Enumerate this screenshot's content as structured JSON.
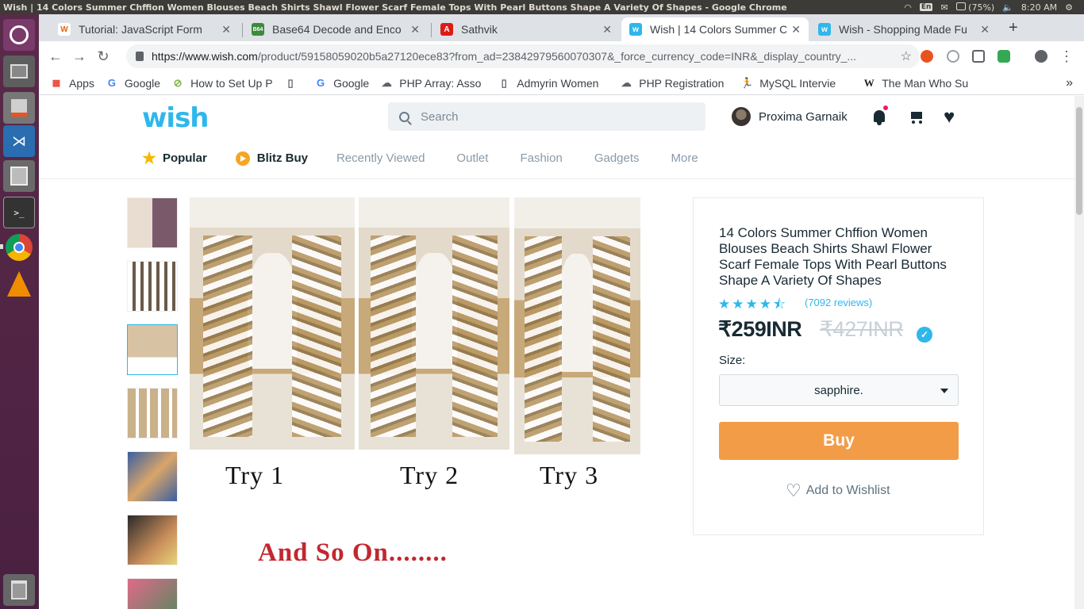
{
  "os": {
    "window_title": "Wish | 14 Colors Summer Chffion Women Blouses Beach Shirts Shawl Flower Scarf Female Tops With Pearl Buttons Shape A Variety Of Shapes - Google Chrome",
    "lang": "En",
    "battery": "(75%)",
    "clock": "8:20 AM"
  },
  "tabs": [
    {
      "label": "Tutorial: JavaScript Form",
      "favicon": "W",
      "favicon_color": "#f2f2f2"
    },
    {
      "label": "Base64 Decode and Enco",
      "favicon": "B64",
      "favicon_color": "#3c8a3c"
    },
    {
      "label": "Sathvik",
      "favicon": "A",
      "favicon_color": "#dd1b16"
    },
    {
      "label": "Wish | 14 Colors Summer C",
      "favicon": "w",
      "favicon_color": "#2fb7ec"
    },
    {
      "label": "Wish - Shopping Made Fu",
      "favicon": "w",
      "favicon_color": "#2fb7ec"
    }
  ],
  "omnibox": {
    "host": "https://www.wish.com",
    "path": "/product/59158059020b5a27120ece83?from_ad=23842979560070307&_force_currency_code=INR&_display_country_..."
  },
  "bookmarks": [
    {
      "label": "Apps",
      "icon": "apps-grid"
    },
    {
      "label": "Google",
      "icon": "google-g"
    },
    {
      "label": "How to Set Up P",
      "icon": "leaf"
    },
    {
      "label": "",
      "icon": "page"
    },
    {
      "label": "Google",
      "icon": "google-g"
    },
    {
      "label": "PHP Array: Asso",
      "icon": "cloud"
    },
    {
      "label": "Admyrin Women",
      "icon": "page"
    },
    {
      "label": "PHP Registration",
      "icon": "cloud"
    },
    {
      "label": "MySQL Intervie",
      "icon": "figure"
    },
    {
      "label": "The Man Who Su",
      "icon": "wiki-w"
    }
  ],
  "site": {
    "logo": "wish",
    "search_placeholder": "Search",
    "user_name": "Proxima Garnaik",
    "nav": [
      {
        "label": "Popular",
        "icon": "star-icon"
      },
      {
        "label": "Blitz Buy",
        "icon": "blitz-icon"
      },
      {
        "label": "Recently Viewed"
      },
      {
        "label": "Outlet"
      },
      {
        "label": "Fashion"
      },
      {
        "label": "Gadgets"
      },
      {
        "label": "More"
      }
    ]
  },
  "product": {
    "title": "14 Colors Summer Chffion Women Blouses Beach Shirts Shawl Flower Scarf Female Tops With Pearl Buttons Shape A Variety Of Shapes",
    "rating_stars": "★★★★⯪",
    "rating": 4.5,
    "reviews": "(7092 reviews)",
    "price": "₹259INR",
    "original_price": "₹427INR",
    "size_label": "Size:",
    "size_selected": "sapphire.",
    "buy_label": "Buy",
    "wishlist_label": "Add to Wishlist"
  },
  "image_text": {
    "try1": "Try 1",
    "try2": "Try 2",
    "try3": "Try 3",
    "more": "And So On........"
  },
  "colors": {
    "brand": "#2fb7ec",
    "buy": "#f39c47",
    "text": "#192a32"
  }
}
